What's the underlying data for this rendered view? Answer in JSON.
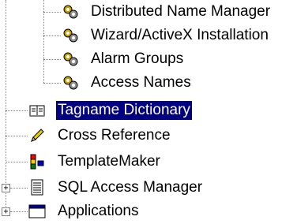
{
  "tree": {
    "items": [
      {
        "label": "Distributed Name Manager",
        "icon": "gears-icon",
        "selected": false
      },
      {
        "label": "Wizard/ActiveX Installation",
        "icon": "gears-icon",
        "selected": false
      },
      {
        "label": "Alarm Groups",
        "icon": "gears-icon",
        "selected": false
      },
      {
        "label": "Access Names",
        "icon": "gears-icon",
        "selected": false
      },
      {
        "label": "Tagname Dictionary",
        "icon": "book-icon",
        "selected": true
      },
      {
        "label": "Cross Reference",
        "icon": "pencil-icon",
        "selected": false
      },
      {
        "label": "TemplateMaker",
        "icon": "templatemaker-icon",
        "selected": false
      },
      {
        "label": "SQL Access Manager",
        "icon": "document-icon",
        "expandable": true,
        "expander": "+"
      },
      {
        "label": "Applications",
        "icon": "window-icon",
        "expandable": true,
        "expander": "+"
      }
    ]
  },
  "colors": {
    "selection_bg": "#000080",
    "selection_text": "#ffffff",
    "tree_lines": "#808080"
  }
}
